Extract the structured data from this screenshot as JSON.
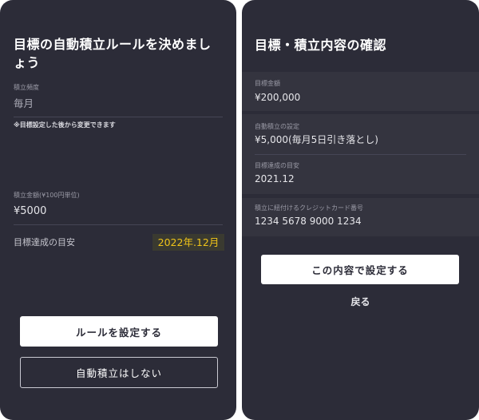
{
  "left": {
    "title": "目標の自動積立ルールを決めましょう",
    "frequency_label": "積立頻度",
    "frequency_value": "毎月",
    "note": "※目標設定した後から変更できます",
    "amount_label": "積立金額(¥100円単位)",
    "amount_value": "¥5000",
    "target_label": "目標達成の目安",
    "target_value": "2022年.12月",
    "primary_button": "ルールを設定する",
    "secondary_button": "自動積立はしない"
  },
  "right": {
    "title": "目標・積立内容の確認",
    "rows": [
      {
        "label": "目標金額",
        "value": "¥200,000"
      },
      {
        "label": "自動積立の設定",
        "value": "¥5,000(毎月5日引き落とし)"
      },
      {
        "label": "目標達成の目安",
        "value": "2021.12"
      },
      {
        "label": "積立に紐付けるクレジットカード番号",
        "value": "1234 5678 9000 1234"
      }
    ],
    "confirm_button": "この内容で設定する",
    "back_link": "戻る"
  },
  "colors": {
    "panel_bg": "#2c2c38",
    "row_bg": "#34343f",
    "highlight_text": "#f0c419",
    "highlight_bg": "#3a3a30"
  }
}
